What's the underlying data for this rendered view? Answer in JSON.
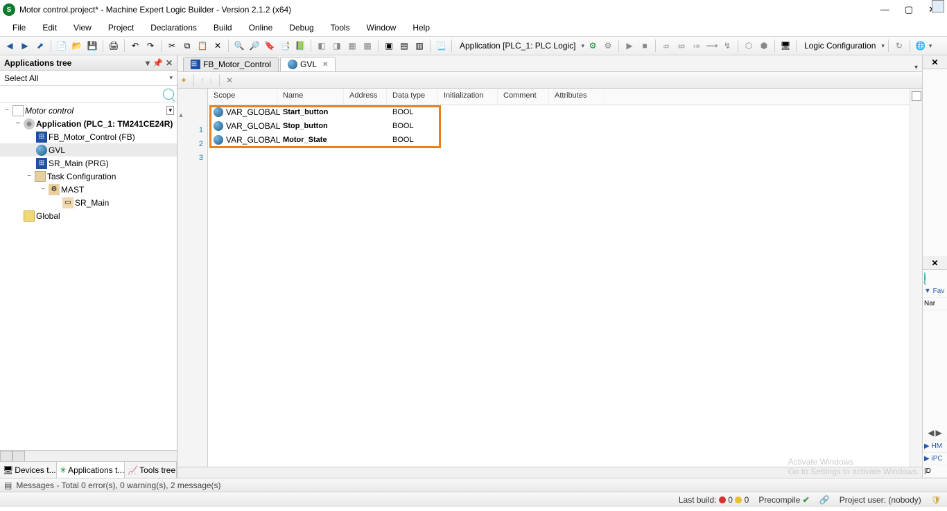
{
  "titlebar": {
    "title": "Motor control.project* - Machine Expert Logic Builder - Version 2.1.2 (x64)"
  },
  "menu": [
    "File",
    "Edit",
    "View",
    "Project",
    "Declarations",
    "Build",
    "Online",
    "Debug",
    "Tools",
    "Window",
    "Help"
  ],
  "toolbar": {
    "app_context": "Application [PLC_1: PLC Logic]",
    "logic_config": "Logic Configuration"
  },
  "left_panel": {
    "title": "Applications tree",
    "select_all": "Select All",
    "tree": {
      "root": "Motor control",
      "app": "Application (PLC_1: TM241CE24R)",
      "fb": "FB_Motor_Control (FB)",
      "gvl": "GVL",
      "sr_main": "SR_Main (PRG)",
      "task_config": "Task Configuration",
      "mast": "MAST",
      "sr_main2": "SR_Main",
      "global": "Global"
    },
    "bottom_tabs": {
      "devices": "Devices t...",
      "apps": "Applications t...",
      "tools": "Tools tree"
    }
  },
  "doc_tabs": {
    "tab1": "FB_Motor_Control",
    "tab2": "GVL"
  },
  "var_table": {
    "headers": {
      "scope": "Scope",
      "name": "Name",
      "address": "Address",
      "datatype": "Data type",
      "init": "Initialization",
      "comment": "Comment",
      "attributes": "Attributes"
    },
    "rows": [
      {
        "scope": "VAR_GLOBAL",
        "name": "Start_button",
        "address": "",
        "datatype": "BOOL",
        "init": "",
        "comment": "",
        "attributes": ""
      },
      {
        "scope": "VAR_GLOBAL",
        "name": "Stop_button",
        "address": "",
        "datatype": "BOOL",
        "init": "",
        "comment": "",
        "attributes": ""
      },
      {
        "scope": "VAR_GLOBAL",
        "name": "Motor_State",
        "address": "",
        "datatype": "BOOL",
        "init": "",
        "comment": "",
        "attributes": ""
      }
    ]
  },
  "right_strip": {
    "fav": "▼ Fav",
    "nar": "Nar",
    "hm": "▶ HM",
    "ipc": "▶ iPC",
    "d": "|D"
  },
  "msgbar": {
    "text": "Messages - Total 0 error(s), 0 warning(s), 2 message(s)"
  },
  "statusbar": {
    "last_build": "Last build:",
    "err": "0",
    "warn": "0",
    "precompile": "Precompile",
    "project_user": "Project user: (nobody)"
  },
  "watermark": {
    "line1": "Activate Windows",
    "line2": "Go to Settings to activate Windows."
  }
}
